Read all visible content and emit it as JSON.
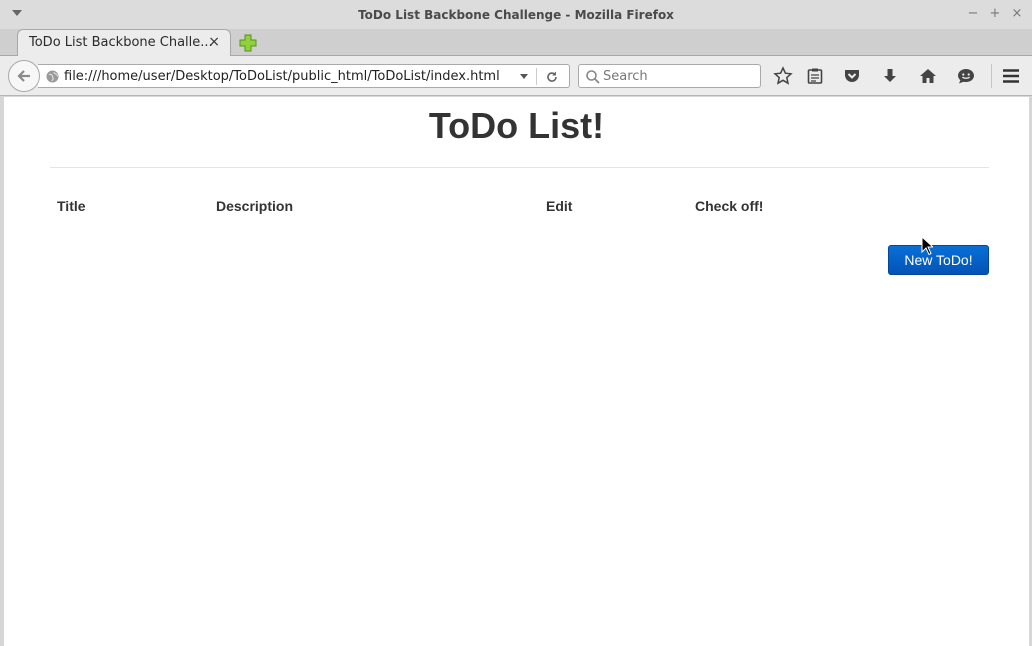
{
  "window": {
    "title": "ToDo List Backbone Challenge - Mozilla Firefox",
    "minimize_glyph": "−",
    "maximize_glyph": "+",
    "close_glyph": "×"
  },
  "tab": {
    "label": "ToDo List Backbone Challe...",
    "close_glyph": "×"
  },
  "navbar": {
    "url": "file:///home/user/Desktop/ToDoList/public_html/ToDoList/index.html",
    "search_placeholder": "Search"
  },
  "icons": {
    "back": "arrow-left-icon",
    "site": "globe-icon",
    "reload": "reload-icon",
    "search": "magnifier-icon",
    "bookmark": "star-icon",
    "reading_list": "clipboard-icon",
    "pocket": "pocket-icon",
    "downloads": "download-arrow-icon",
    "home": "home-icon",
    "hello": "chat-smiley-icon",
    "menu": "hamburger-icon",
    "new_tab": "plus-icon"
  },
  "page": {
    "heading": "ToDo List!",
    "columns": [
      "Title",
      "Description",
      "Edit",
      "Check off!"
    ],
    "new_button_label": "New ToDo!"
  },
  "colors": {
    "button": "#0a62c9",
    "heading": "#333333",
    "new_tab_plus": "#7cbf2a"
  }
}
